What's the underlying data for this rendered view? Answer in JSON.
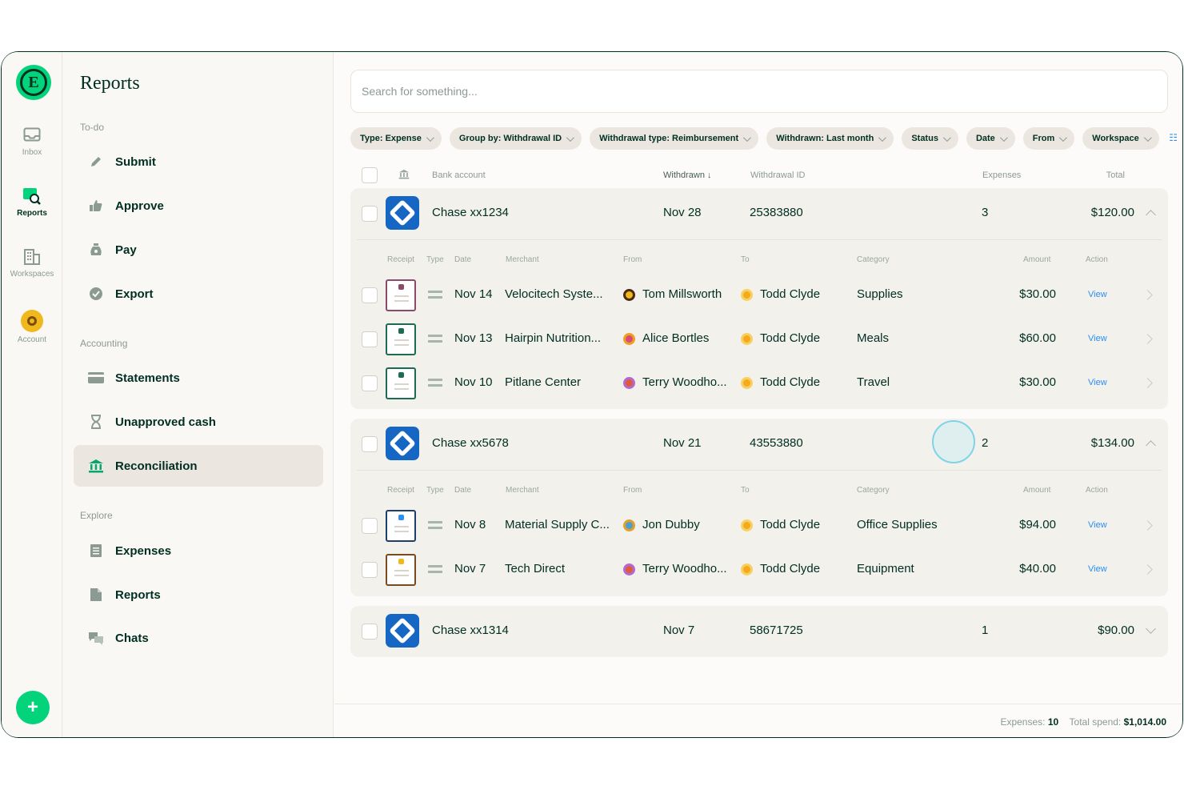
{
  "rail": {
    "items": [
      {
        "label": "Inbox"
      },
      {
        "label": "Reports"
      },
      {
        "label": "Workspaces"
      },
      {
        "label": "Account"
      }
    ],
    "fab_label": "+"
  },
  "nav": {
    "title": "Reports",
    "sections": {
      "todo": "To-do",
      "accounting": "Accounting",
      "explore": "Explore"
    },
    "todo_items": [
      "Submit",
      "Approve",
      "Pay",
      "Export"
    ],
    "accounting_items": [
      "Statements",
      "Unapproved cash",
      "Reconciliation"
    ],
    "explore_items": [
      "Expenses",
      "Reports",
      "Chats"
    ]
  },
  "search": {
    "placeholder": "Search for something..."
  },
  "filters": [
    "Type: Expense",
    "Group by: Withdrawal ID",
    "Withdrawal type: Reimbursement",
    "Withdrawn: Last month",
    "Status",
    "Date",
    "From",
    "Workspace"
  ],
  "table": {
    "headers": {
      "bank_account": "Bank account",
      "withdrawn": "Withdrawn ↓",
      "withdrawal_id": "Withdrawal ID",
      "expenses": "Expenses",
      "total": "Total"
    },
    "sub_headers": {
      "receipt": "Receipt",
      "type": "Type",
      "date": "Date",
      "merchant": "Merchant",
      "from": "From",
      "to": "To",
      "category": "Category",
      "amount": "Amount",
      "action": "Action"
    },
    "groups": [
      {
        "bank": "Chase xx1234",
        "withdrawn": "Nov 28",
        "withdrawal_id": "25383880",
        "expenses": "3",
        "total": "$120.00",
        "expanded": true,
        "rows": [
          {
            "date": "Nov 14",
            "merchant": "Velocitech Syste...",
            "from": "Tom Millsworth",
            "to": "Todd Clyde",
            "category": "Supplies",
            "amount": "$30.00",
            "action": "View"
          },
          {
            "date": "Nov 13",
            "merchant": "Hairpin Nutrition...",
            "from": "Alice Bortles",
            "to": "Todd Clyde",
            "category": "Meals",
            "amount": "$60.00",
            "action": "View"
          },
          {
            "date": "Nov 10",
            "merchant": "Pitlane Center",
            "from": "Terry Woodho...",
            "to": "Todd Clyde",
            "category": "Travel",
            "amount": "$30.00",
            "action": "View"
          }
        ]
      },
      {
        "bank": "Chase xx5678",
        "withdrawn": "Nov 21",
        "withdrawal_id": "43553880",
        "expenses": "2",
        "total": "$134.00",
        "expanded": true,
        "rows": [
          {
            "date": "Nov 8",
            "merchant": "Material Supply C...",
            "from": "Jon Dubby",
            "to": "Todd Clyde",
            "category": "Office Supplies",
            "amount": "$94.00",
            "action": "View"
          },
          {
            "date": "Nov 7",
            "merchant": "Tech Direct",
            "from": "Terry Woodho...",
            "to": "Todd Clyde",
            "category": "Equipment",
            "amount": "$40.00",
            "action": "View"
          }
        ]
      },
      {
        "bank": "Chase xx1314",
        "withdrawn": "Nov 7",
        "withdrawal_id": "58671725",
        "expenses": "1",
        "total": "$90.00",
        "expanded": false,
        "rows": []
      }
    ]
  },
  "footer": {
    "expenses_label": "Expenses:",
    "expenses_value": "10",
    "total_label": "Total spend:",
    "total_value": "$1,014.00"
  },
  "colors": {
    "brand_green": "#03d47c",
    "dark_green": "#002e22",
    "link_blue": "#2a8ef5",
    "chase_blue": "#1666c4"
  }
}
